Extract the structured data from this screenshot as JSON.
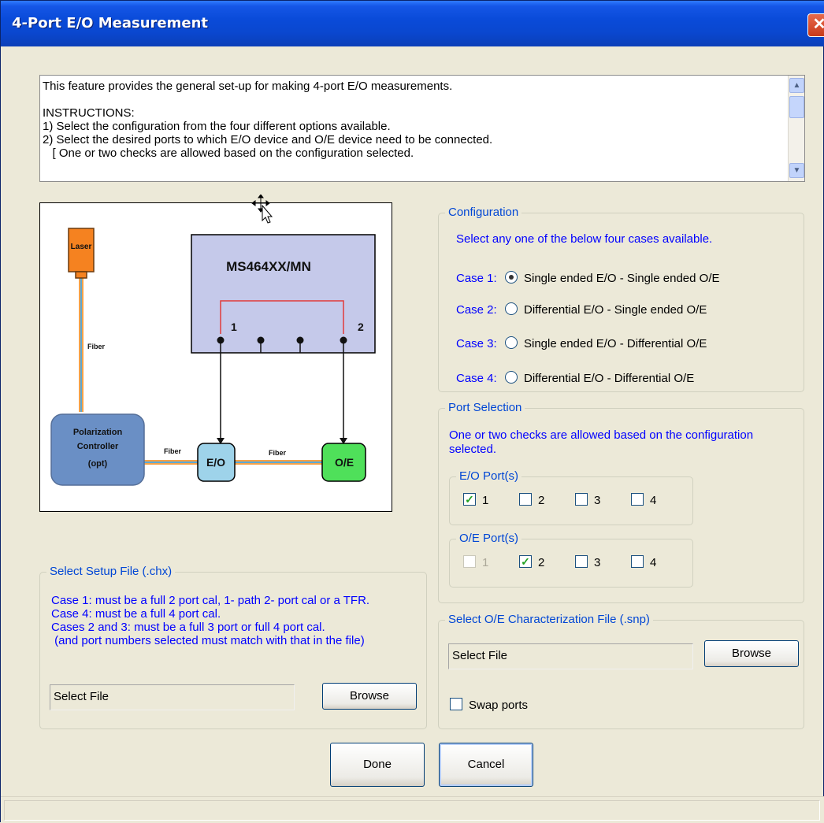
{
  "window": {
    "title": "4-Port E/O Measurement",
    "close_glyph": "✕"
  },
  "info": {
    "lines": [
      "This feature provides the general set-up for making 4-port E/O measurements.",
      "",
      "INSTRUCTIONS:",
      "1) Select the configuration from the four different options available.",
      "2) Select the desired ports to which E/O device and O/E device need to be connected.",
      "   [ One or two checks are allowed based on the configuration selected."
    ]
  },
  "diagram": {
    "vna": "MS464XX/MN",
    "laser": "Laser",
    "fiber": "Fiber",
    "polarization": [
      "Polarization",
      "Controller",
      "(opt)"
    ],
    "eo": "E/O",
    "oe": "O/E",
    "port1": "1",
    "port2": "2",
    "colors": {
      "laser": "#f58220",
      "fiber": "#f5a24a",
      "vna_box": "#c5c9ea",
      "eo_box": "#9ed3ea",
      "oe_box": "#4fe05a",
      "pc_box": "#6a8fc5",
      "port_link": "#e23b3b"
    }
  },
  "configuration": {
    "legend": "Configuration",
    "prompt": "Select any one of the below four cases available.",
    "cases": [
      {
        "label": "Case 1:",
        "text": "Single ended E/O - Single ended O/E",
        "selected": true
      },
      {
        "label": "Case 2:",
        "text": "Differential E/O - Single ended O/E",
        "selected": false
      },
      {
        "label": "Case 3:",
        "text": "Single ended E/O - Differential O/E",
        "selected": false
      },
      {
        "label": "Case 4:",
        "text": "Differential E/O - Differential O/E",
        "selected": false
      }
    ]
  },
  "ports": {
    "legend": "Port Selection",
    "note1": "One or two checks are allowed based on the configuration",
    "note2": "selected.",
    "eo": {
      "legend": "E/O Port(s)",
      "items": [
        {
          "label": "1",
          "checked": true,
          "enabled": true
        },
        {
          "label": "2",
          "checked": false,
          "enabled": true
        },
        {
          "label": "3",
          "checked": false,
          "enabled": true
        },
        {
          "label": "4",
          "checked": false,
          "enabled": true
        }
      ]
    },
    "oe": {
      "legend": "O/E Port(s)",
      "items": [
        {
          "label": "1",
          "checked": false,
          "enabled": false
        },
        {
          "label": "2",
          "checked": true,
          "enabled": true
        },
        {
          "label": "3",
          "checked": false,
          "enabled": true
        },
        {
          "label": "4",
          "checked": false,
          "enabled": true
        }
      ]
    }
  },
  "setup_file": {
    "legend": "Select Setup File (.chx)",
    "notes": [
      "Case 1:  must be a full 2 port cal, 1- path 2- port cal or a TFR.",
      "Case 4:  must be a full 4 port cal.",
      "Cases 2 and 3:  must be a full 3 port or full 4 port cal.",
      " (and port numbers selected must match with that in the file)"
    ],
    "file_value": "Select File",
    "browse_label": "Browse"
  },
  "oe_file": {
    "legend": "Select O/E Characterization File (.snp)",
    "file_value": "Select File",
    "browse_label": "Browse",
    "swap_label": "Swap ports",
    "swap_checked": false
  },
  "buttons": {
    "done": "Done",
    "cancel": "Cancel"
  }
}
